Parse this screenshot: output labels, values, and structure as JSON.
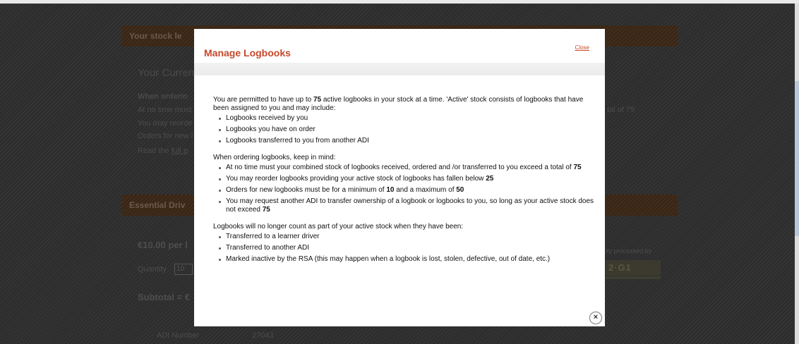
{
  "background": {
    "stock_bar_title": "Your stock le",
    "current_label": "Your Curren",
    "when_ordering": "When orderin",
    "bullets": [
      "At no time must",
      "You may reorde",
      "Orders for new l"
    ],
    "read_the": "Read the",
    "read_the_link": "full p",
    "right_fragment": "tal of 75",
    "essential_bar_title": "Essential Driv",
    "price": "€10.00 per l",
    "quantity_label": "Quantity",
    "quantity_value": "10",
    "subtotal": "Subtotal = €",
    "processed_by": "ity processed by",
    "brand_text": "2·G1",
    "adi_label": "ADI Number",
    "adi_value": "27043"
  },
  "modal": {
    "title": "Manage Logbooks",
    "close_link": "Close",
    "intro_pre": "You are permitted to have up to ",
    "intro_num": "75",
    "intro_post": " active logbooks in your stock at a time. 'Active' stock consists of logbooks that have been assigned to you and may include:",
    "active_items": [
      "Logbooks received by you",
      "Logbooks you have on order",
      "Logbooks transferred to you from another ADI"
    ],
    "keep_in_mind": "When ordering logbooks, keep in mind:",
    "rule1_pre": "At no time must your combined stock of logbooks received, ordered and /or transferred to you exceed a total of ",
    "rule1_num": "75",
    "rule2_pre": "You may reorder logbooks providing your active stock of logbooks has fallen below ",
    "rule2_num": "25",
    "rule3_pre": "Orders for new logbooks must be for a minimum of ",
    "rule3_min": "10",
    "rule3_mid": " and a maximum of ",
    "rule3_max": "50",
    "rule4_pre": "You may request another ADI to transfer ownership of a logbook or logbooks to you, so long as your active stock does not exceed ",
    "rule4_num": "75",
    "no_longer": "Logbooks will no longer count as part of your active stock when they have been:",
    "inactive_items": [
      "Transferred to a learner driver",
      "Transferred to another ADI",
      "Marked inactive by the RSA (this may happen when a logbook is lost, stolen, defective, out of date, etc.)"
    ],
    "close_icon_glyph": "×"
  }
}
